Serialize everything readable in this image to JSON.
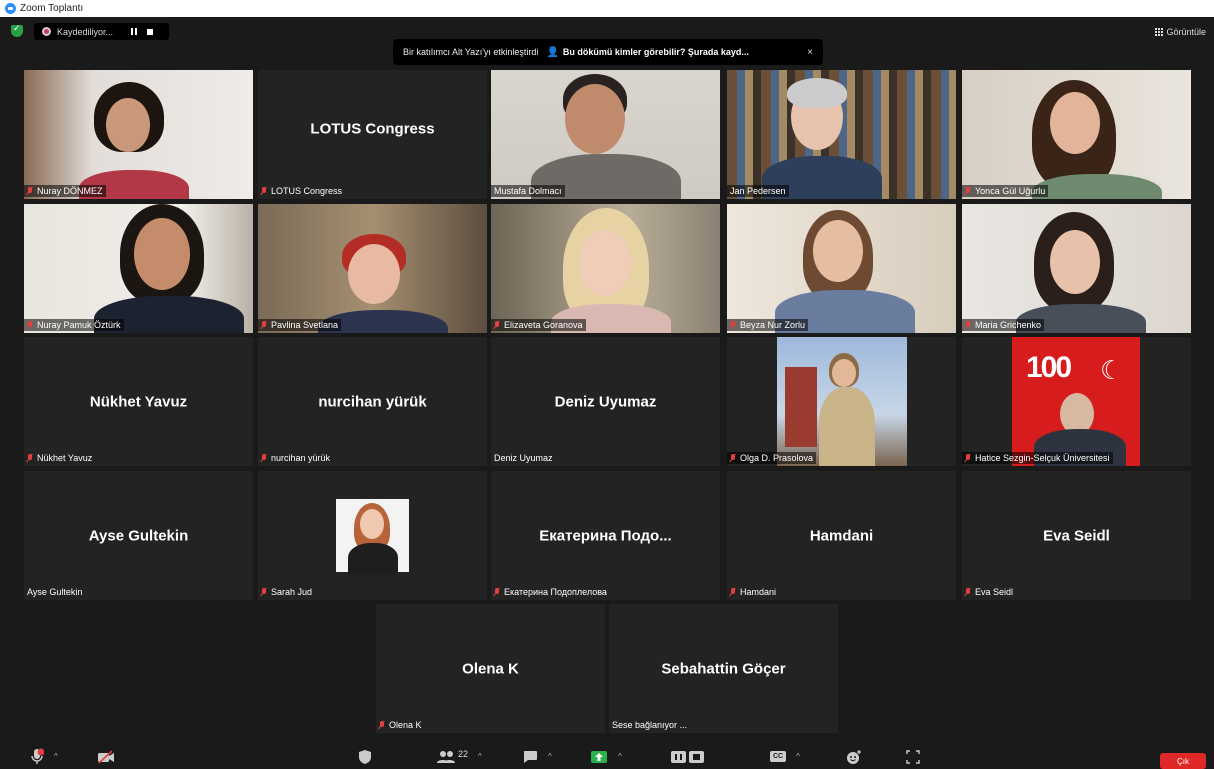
{
  "window": {
    "title": "Zoom Toplantı"
  },
  "topbar": {
    "recording_label": "Kaydediliyor...",
    "caption_text": "Bir katılımcı Alt Yazı'yı etkinleştirdi",
    "caption_link": "Bu dökümü kimler görebilir? Şurada kayd...",
    "close_symbol": "×",
    "view_label": "Görüntüle"
  },
  "tiles": [
    {
      "id": "nuray-donmez",
      "name": "Nuray DÖNMEZ",
      "muted": true,
      "video": true
    },
    {
      "id": "lotus-congress",
      "name": "LOTUS Congress",
      "muted": true,
      "video": false,
      "display": "LOTUS Congress"
    },
    {
      "id": "mustafa-dolmaci",
      "name": "Mustafa Dolmacı",
      "muted": false,
      "video": true,
      "speaking": true
    },
    {
      "id": "jan-pedersen",
      "name": "Jan Pedersen",
      "muted": false,
      "video": true
    },
    {
      "id": "yonca-gul-ugurlu",
      "name": "Yonca Gül Uğurlu",
      "muted": true,
      "video": true
    },
    {
      "id": "nuray-pamuk-ozturk",
      "name": "Nuray Pamuk Öztürk",
      "muted": true,
      "video": true
    },
    {
      "id": "pavlina-svetlana",
      "name": "Pavlina Svetlana",
      "muted": true,
      "video": true
    },
    {
      "id": "elizaveta-goranova",
      "name": "Elizaveta Goranova",
      "muted": true,
      "video": true
    },
    {
      "id": "beyza-nur-zorlu",
      "name": "Beyza Nur Zorlu",
      "muted": true,
      "video": true
    },
    {
      "id": "maria-grichenko",
      "name": "Maria Grichenko",
      "muted": true,
      "video": true
    },
    {
      "id": "nukhet-yavuz",
      "name": "Nükhet Yavuz",
      "muted": true,
      "video": false,
      "display": "Nükhet Yavuz"
    },
    {
      "id": "nurcihan-yuruk",
      "name": "nurcihan yürük",
      "muted": true,
      "video": false,
      "display": "nurcihan yürük"
    },
    {
      "id": "deniz-uyumaz",
      "name": "Deniz Uyumaz",
      "muted": false,
      "video": false,
      "display": "Deniz Uyumaz"
    },
    {
      "id": "olga-prasolova",
      "name": "Olga D. Prasolova",
      "muted": true,
      "video": true
    },
    {
      "id": "hatice-sezgin",
      "name": "Hatice Sezgin-Selçuk Üniversitesi",
      "muted": true,
      "video": true,
      "badge": "100"
    },
    {
      "id": "ayse-gultekin",
      "name": "Ayse Gultekin",
      "muted": false,
      "video": false,
      "display": "Ayse Gultekin"
    },
    {
      "id": "sarah-jud",
      "name": "Sarah Jud",
      "muted": true,
      "video": true
    },
    {
      "id": "ekaterina",
      "name": "Екатерина Подоплелова",
      "muted": true,
      "video": false,
      "display": "Екатерина  Подо..."
    },
    {
      "id": "hamdani",
      "name": "Hamdani",
      "muted": true,
      "video": false,
      "display": "Hamdani"
    },
    {
      "id": "eva-seidl",
      "name": "Eva Seidl",
      "muted": true,
      "video": false,
      "display": "Eva Seidl"
    },
    {
      "id": "olena-k",
      "name": "Olena K",
      "muted": true,
      "video": false,
      "display": "Olena K"
    },
    {
      "id": "sebahattin-gocer",
      "name": "Sese bağlanıyor ...",
      "muted": false,
      "video": false,
      "display": "Sebahattin Göçer"
    }
  ],
  "toolbar": {
    "participants_count": "22",
    "caret": "^",
    "leave_label": "Çık",
    "cc_label": "CC"
  },
  "colors": {
    "speaking_border": "#d4e157",
    "leave": "#e02828",
    "mic_off": "#e23f3f",
    "shield": "#27a145"
  }
}
